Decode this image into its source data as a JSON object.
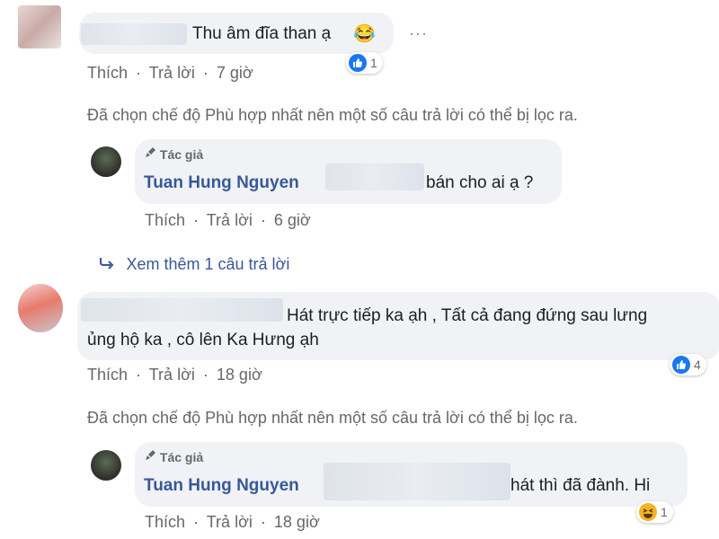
{
  "comments": [
    {
      "text": "Thu âm đĩa than ạ",
      "emoji": "😂",
      "actions": {
        "like": "Thích",
        "reply": "Trả lời",
        "sep": "·",
        "time": "7 giờ"
      },
      "reactions": {
        "type": "like",
        "count": "1"
      },
      "more_options": "···",
      "filter_note": "Đã chọn chế độ Phù hợp nhất nên một số câu trả lời có thể bị lọc ra.",
      "reply": {
        "author_badge": "Tác giả",
        "name": "Tuan Hung Nguyen",
        "text": "bán cho ai ạ ?",
        "actions": {
          "like": "Thích",
          "reply": "Trả lời",
          "sep": "·",
          "time": "6 giờ"
        }
      },
      "view_more": "Xem thêm 1 câu trả lời"
    },
    {
      "text_line1": "Hát trực tiếp ka ạh , Tất cả đang đứng sau lưng",
      "text_line2": "ủng hộ ka , cô lên Ka Hưng ạh",
      "actions": {
        "like": "Thích",
        "reply": "Trả lời",
        "sep": "·",
        "time": "18 giờ"
      },
      "reactions": {
        "type": "like",
        "count": "4"
      },
      "filter_note": "Đã chọn chế độ Phù hợp nhất nên một số câu trả lời có thể bị lọc ra.",
      "reply": {
        "author_badge": "Tác giả",
        "name": "Tuan Hung Nguyen",
        "text": "hát thì đã đành. Hi",
        "actions": {
          "like": "Thích",
          "reply": "Trả lời",
          "sep": "·",
          "time": "18 giờ"
        },
        "reactions": {
          "type": "haha",
          "count": "1"
        }
      }
    }
  ],
  "colors": {
    "bubble": "#f0f2f5",
    "name": "#385898",
    "meta": "#65676b",
    "like": "#1877f2",
    "haha": "#f7b125"
  }
}
